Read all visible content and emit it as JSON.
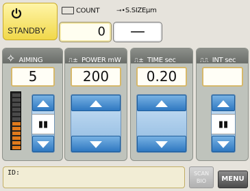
{
  "standby": {
    "label": "STANDBY",
    "icon": "power-icon",
    "color": "#f4df5a"
  },
  "header": {
    "count_label": "COUNT",
    "size_label": "S.SIZEµm"
  },
  "count": {
    "value": "0"
  },
  "spot_size": {
    "value": "—"
  },
  "aiming": {
    "label": "AIMING",
    "value": "5",
    "level_fraction": 0.5,
    "thumb": "▮▮"
  },
  "power": {
    "label": "POWER mW",
    "value": "200"
  },
  "time": {
    "label": "TIME sec",
    "value": "0.20"
  },
  "interval": {
    "label": "INT sec",
    "value": "",
    "thumb": "▮▮"
  },
  "footer": {
    "id_label": "ID:",
    "scan_bio": "SCAN BIO",
    "menu": "MENU"
  },
  "colors": {
    "value_border": "#d6b86a",
    "header_bg": "#7b7e79",
    "stepper_blue": "#2f78c1"
  }
}
